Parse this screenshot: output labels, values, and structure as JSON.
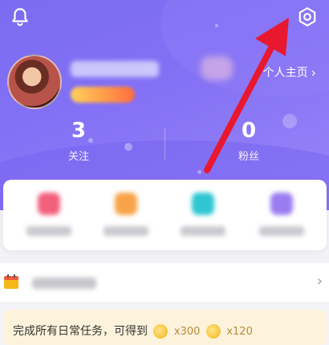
{
  "header": {
    "homepage_label": "个人主页",
    "homepage_chevron": "›",
    "follow_count": "3",
    "follow_label": "关注",
    "fans_count": "0",
    "fans_label": "粉丝"
  },
  "icons": {
    "bell": "bell-icon",
    "settings": "gear-icon",
    "calendar": "calendar-icon",
    "coin": "coin-icon"
  },
  "row": {
    "chevron": "›"
  },
  "task": {
    "text": "完成所有日常任务，可得到",
    "reward1": "x300",
    "reward2": "x120"
  },
  "colors": {
    "header_gradient_start": "#7a6cf2",
    "header_gradient_end": "#9a86f7",
    "arrow": "#e8182f",
    "task_bg": "#fdf3dc"
  }
}
